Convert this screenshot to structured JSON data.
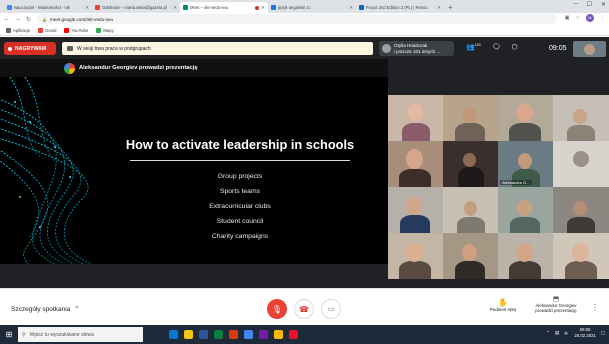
{
  "browser": {
    "tabs": [
      {
        "title": "Nauczyciel - Wiadomości - nik",
        "color": "#4285f4",
        "active": false
      },
      {
        "title": "Odebrane - marta.wisia@gazeta.pl",
        "color": "#ea4335",
        "active": false
      },
      {
        "title": "Meet – nkt-vedu-xeu",
        "color": "#00897b",
        "active": true,
        "recording": true
      },
      {
        "title": "język angielski 1c",
        "color": "#1a73e8",
        "active": false
      },
      {
        "title": "Focus 2nd Edition 2 (PL) | Resou",
        "color": "#1565c0",
        "active": false
      }
    ],
    "new_tab": "+",
    "window_controls": [
      "–",
      "☐",
      "✕"
    ],
    "address": "meet.google.com/nkt-vedu-xeu",
    "profile_initial": "M",
    "bookmarks": [
      {
        "label": "Aplikacje",
        "color": "#5f6368"
      },
      {
        "label": "Gmail",
        "color": "#ea4335"
      },
      {
        "label": "YouTube",
        "color": "#ff0000"
      },
      {
        "label": "Mapy",
        "color": "#34a853"
      }
    ]
  },
  "meet": {
    "recording_label": "NAGRYWAM",
    "breakout_text": "W sesji trwa praca w podgrupach",
    "presenter_box": {
      "line1": "Otylia Hnaticzak",
      "line2": "i jeszcze 101 innych ..."
    },
    "participants_count": "120",
    "clock": "09:05",
    "presentation_banner": "Aleksandur Georgiev prowadzi prezentację",
    "slide": {
      "title": "How to activate leadership in schools",
      "bullets": [
        "Group projects",
        "Sports teams",
        "Extracurricular clubs",
        "Student council",
        "Charity campaigns"
      ]
    },
    "tile_names": {
      "t11": "Aleksandur G..."
    },
    "bottom": {
      "details_label": "Szczegóły spotkania",
      "raise_hand": "Podnieś rękę",
      "presenting_line1": "Aleksandur Georgiev",
      "presenting_line2": "prowadzi prezentację"
    }
  },
  "taskbar": {
    "search_placeholder": "Wpisz tu wyszukiwane słowa",
    "time": "09:05",
    "date": "25.02.2021",
    "apps": [
      "#0078d4",
      "#f2c811",
      "#2b579a",
      "#0a7e3e",
      "#d83b01",
      "#4285f4",
      "#7719aa",
      "#ffb900",
      "#e81123"
    ]
  }
}
